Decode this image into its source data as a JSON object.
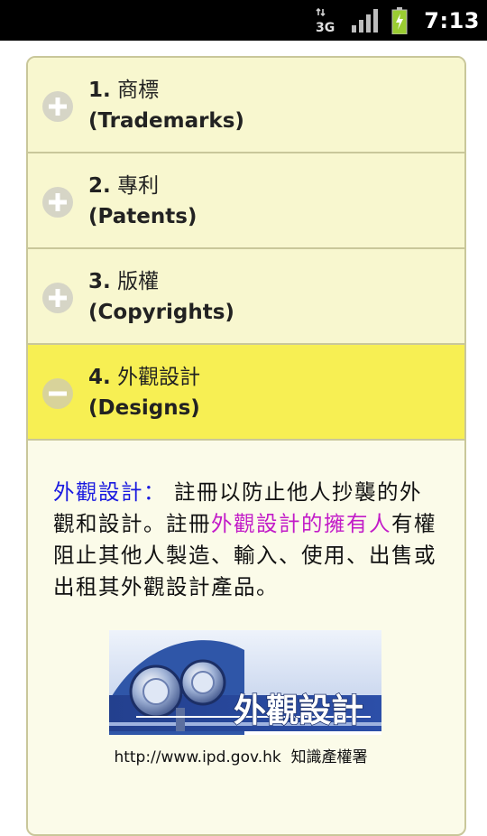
{
  "status_bar": {
    "network": "3G",
    "time": "7:13"
  },
  "accordion": {
    "sections": [
      {
        "number": "1.",
        "title_zh": "商標",
        "title_en": "(Trademarks)",
        "expanded": false
      },
      {
        "number": "2.",
        "title_zh": "專利",
        "title_en": "(Patents)",
        "expanded": false
      },
      {
        "number": "3.",
        "title_zh": "版權",
        "title_en": "(Copyrights)",
        "expanded": false
      },
      {
        "number": "4.",
        "title_zh": "外觀設計",
        "title_en": "(Designs)",
        "expanded": true
      }
    ]
  },
  "designs": {
    "term": "外觀設計：",
    "text_1": " 註冊以防止他人抄襲的外觀和設計。註冊",
    "owner": "外觀設計的擁有人",
    "text_2": "有權阻止其他人製造、輸入、使用、出售或出租其外觀設計產品。",
    "logo_text": "外觀設計",
    "caption_url": "http://www.ipd.gov.hk",
    "caption_org": "知識產權署"
  },
  "colors": {
    "header_bg": "#f8f7cf",
    "header_active_bg": "#f7ef53",
    "body_bg": "#fbfbe9",
    "term_color": "#1a1ae0",
    "owner_color": "#c21bc8"
  }
}
